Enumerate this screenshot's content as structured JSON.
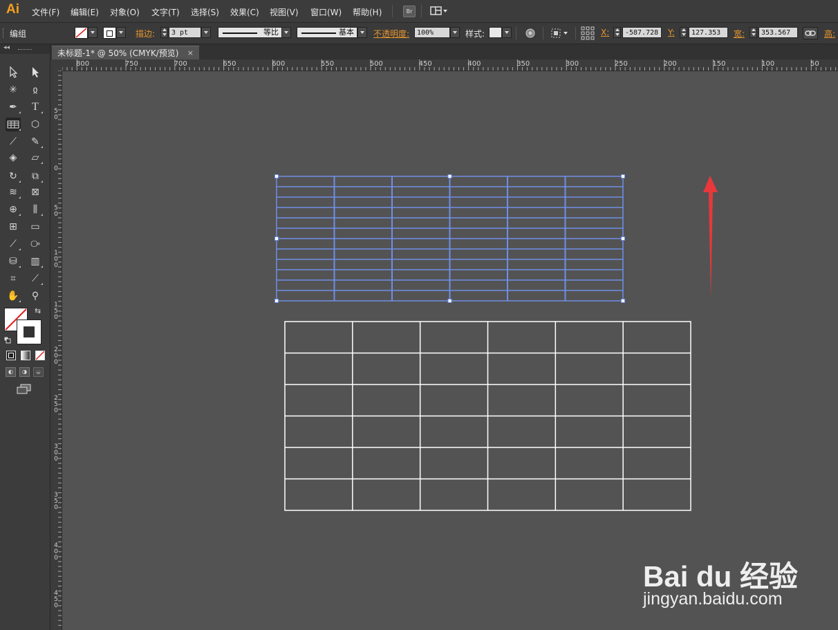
{
  "app": {
    "logo": "Ai"
  },
  "menubar": {
    "items": [
      "文件(F)",
      "编辑(E)",
      "对象(O)",
      "文字(T)",
      "选择(S)",
      "效果(C)",
      "视图(V)",
      "窗口(W)",
      "帮助(H)"
    ],
    "bridge_label": "Br"
  },
  "controlbar": {
    "selection_type": "编组",
    "stroke_label": "描边:",
    "stroke_weight": "3 pt",
    "profile_label": "等比",
    "brush_label": "基本",
    "opacity_label": "不透明度:",
    "opacity_value": "100%",
    "style_label": "样式:",
    "x_label": "X:",
    "x_value": "-587.728",
    "y_label": "Y:",
    "y_value": "127.353",
    "w_label": "宽:",
    "w_value": "353.567",
    "h_label": "高:"
  },
  "document": {
    "tab_title": "未标题-1* @ 50% (CMYK/预览)",
    "close_glyph": "×"
  },
  "ruler": {
    "horizontal": [
      "800",
      "750",
      "700",
      "650",
      "600",
      "550",
      "500",
      "450",
      "400",
      "350",
      "300",
      "250",
      "200",
      "150",
      "100",
      "50"
    ],
    "vertical": [
      "5\n0",
      "0",
      "5\n0",
      "1\n0\n0",
      "1\n5\n0",
      "2\n0\n0",
      "2\n5\n0",
      "3\n0\n0",
      "3\n5\n0",
      "4\n0\n0",
      "4\n5\n0"
    ]
  },
  "selected_grid": {
    "columns": 6,
    "rows": 12,
    "color": "#6f8fe6"
  },
  "white_grid": {
    "columns": 6,
    "rows": 6,
    "color": "#ffffff"
  },
  "arrow": {
    "color": "#e8383b"
  },
  "watermark": {
    "brand": "Bai du 经验",
    "url": "jingyan.baidu.com"
  }
}
